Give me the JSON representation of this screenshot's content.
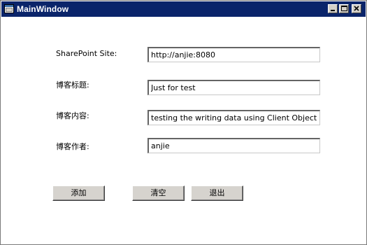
{
  "window": {
    "title": "MainWindow"
  },
  "form": {
    "site_label": "SharePoint Site:",
    "site_value": "http://anjie:8080",
    "blog_title_label": "博客标题:",
    "blog_title_value": "Just for test",
    "blog_content_label": "博客内容:",
    "blog_content_value": "testing the writing data using Client Object Model",
    "blog_author_label": "博客作者:",
    "blog_author_value": "anjie"
  },
  "buttons": {
    "add_label": "添加",
    "clear_label": "清空",
    "exit_label": "退出"
  },
  "colors": {
    "titlebar": "#0a246a",
    "button_face": "#d6d3ce"
  },
  "icons": {
    "app": "window-icon",
    "minimize": "minimize-icon",
    "maximize": "maximize-icon",
    "close": "close-icon"
  }
}
